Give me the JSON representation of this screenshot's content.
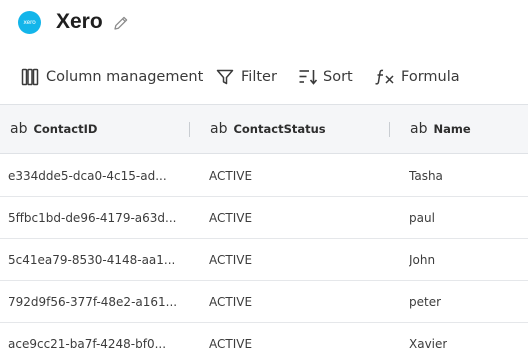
{
  "header": {
    "logo_text": "xero",
    "title": "Xero",
    "edit_icon": "pencil-icon"
  },
  "toolbar": {
    "column_management_label": "Column management",
    "filter_label": "Filter",
    "sort_label": "Sort",
    "formula_label": "Formula"
  },
  "table": {
    "type_badge": "ab",
    "columns": [
      {
        "label": "ContactID"
      },
      {
        "label": "ContactStatus"
      },
      {
        "label": "Name"
      }
    ],
    "rows": [
      {
        "id": "e334dde5-dca0-4c15-ad...",
        "status": "ACTIVE",
        "name": "Tasha"
      },
      {
        "id": "5ffbc1bd-de96-4179-a63d...",
        "status": "ACTIVE",
        "name": "paul"
      },
      {
        "id": "5c41ea79-8530-4148-aa1...",
        "status": "ACTIVE",
        "name": "John"
      },
      {
        "id": "792d9f56-377f-48e2-a161...",
        "status": "ACTIVE",
        "name": "peter"
      },
      {
        "id": "ace9cc21-ba7f-4248-bf0...",
        "status": "ACTIVE",
        "name": "Xavier"
      }
    ]
  },
  "colors": {
    "brand": "#13b5ea",
    "header_bg": "#f5f6f8",
    "border": "#dfe2e6"
  }
}
